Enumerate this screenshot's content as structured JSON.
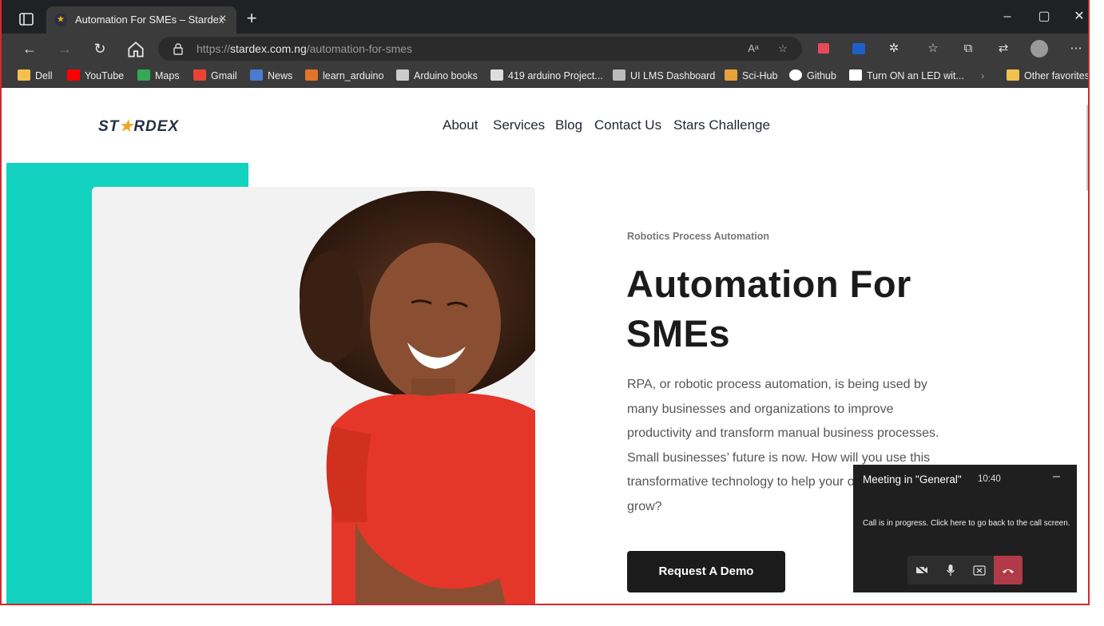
{
  "browser": {
    "tab_title": "Automation For SMEs – Stardex",
    "new_tab": "+",
    "url_scheme": "https://",
    "url_domain": "stardex.com.ng",
    "url_path": "/automation-for-smes",
    "bookmarks": [
      {
        "label": "Dell",
        "color": "#f2c14e"
      },
      {
        "label": "YouTube",
        "color": "#ff0000"
      },
      {
        "label": "Maps",
        "color": "#34a853"
      },
      {
        "label": "Gmail",
        "color": "#ea4335"
      },
      {
        "label": "News",
        "color": "#4a7bd0"
      },
      {
        "label": "learn_arduino",
        "color": "#e2742a"
      },
      {
        "label": "Arduino books",
        "color": "#cccccc"
      },
      {
        "label": "419 arduino Project...",
        "color": "#dddddd"
      },
      {
        "label": "UI LMS Dashboard",
        "color": "#bbbbbb"
      },
      {
        "label": "Sci-Hub",
        "color": "#e8a23a"
      },
      {
        "label": "Github",
        "color": "#ffffff"
      },
      {
        "label": "Turn ON an LED wit...",
        "color": "#ffffff"
      },
      {
        "label": "Other favorites",
        "color": "#f2c14e"
      }
    ]
  },
  "site": {
    "logo_pre": "ST",
    "logo_star": "★",
    "logo_post": "RDEX",
    "nav": [
      "About",
      "Services",
      "Blog",
      "Contact Us",
      "Stars Challenge"
    ],
    "eyebrow": "Robotics Process Automation",
    "headline": "Automation For SMEs",
    "body": "RPA, or robotic process automation, is being used by many businesses and organizations to improve productivity and transform manual business processes. Small businesses’ future is now. How will you use this transformative technology to help your organization grow?",
    "cta": "Request A Demo"
  },
  "meeting": {
    "title": "Meeting in \"General\"",
    "time": "10:40",
    "status": "Call is in progress. Click here to go back to the call screen."
  }
}
